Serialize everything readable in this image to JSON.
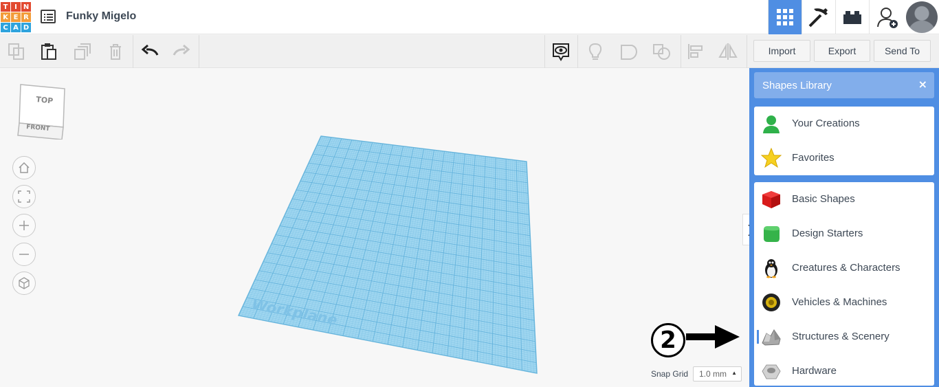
{
  "app": {
    "logo_letters": [
      "T",
      "I",
      "N",
      "K",
      "E",
      "R",
      "C",
      "A",
      "D"
    ],
    "project_title": "Funky Migelo"
  },
  "header": {
    "buttons": [
      {
        "name": "3d-design-view",
        "icon": "grid-icon",
        "active": true
      },
      {
        "name": "blocks-view",
        "icon": "pickaxe-icon",
        "active": false
      },
      {
        "name": "bricks-view",
        "icon": "brick-icon",
        "active": false
      },
      {
        "name": "add-user",
        "icon": "add-user-icon",
        "active": false
      }
    ]
  },
  "toolbar": {
    "import_label": "Import",
    "export_label": "Export",
    "sendto_label": "Send To"
  },
  "viewcube": {
    "top_label": "TOP",
    "front_label": "FRONT"
  },
  "workplane": {
    "label": "Workplane"
  },
  "snap_grid": {
    "label": "Snap Grid",
    "value": "1.0 mm"
  },
  "annotation": {
    "step_number": "2"
  },
  "shapes_library": {
    "title": "Shapes Library",
    "close_glyph": "×",
    "personal": [
      {
        "label": "Your Creations",
        "icon": "person-icon"
      },
      {
        "label": "Favorites",
        "icon": "star-icon"
      }
    ],
    "categories": [
      {
        "label": "Basic Shapes",
        "icon": "red-cube-icon"
      },
      {
        "label": "Design Starters",
        "icon": "green-cube-icon"
      },
      {
        "label": "Creatures & Characters",
        "icon": "penguin-icon"
      },
      {
        "label": "Vehicles & Machines",
        "icon": "wheel-icon"
      },
      {
        "label": "Structures & Scenery",
        "icon": "rocks-icon"
      },
      {
        "label": "Hardware",
        "icon": "nut-icon"
      }
    ]
  },
  "colors": {
    "accent": "#4f8ee3",
    "workplane": "#8fd0ee"
  }
}
